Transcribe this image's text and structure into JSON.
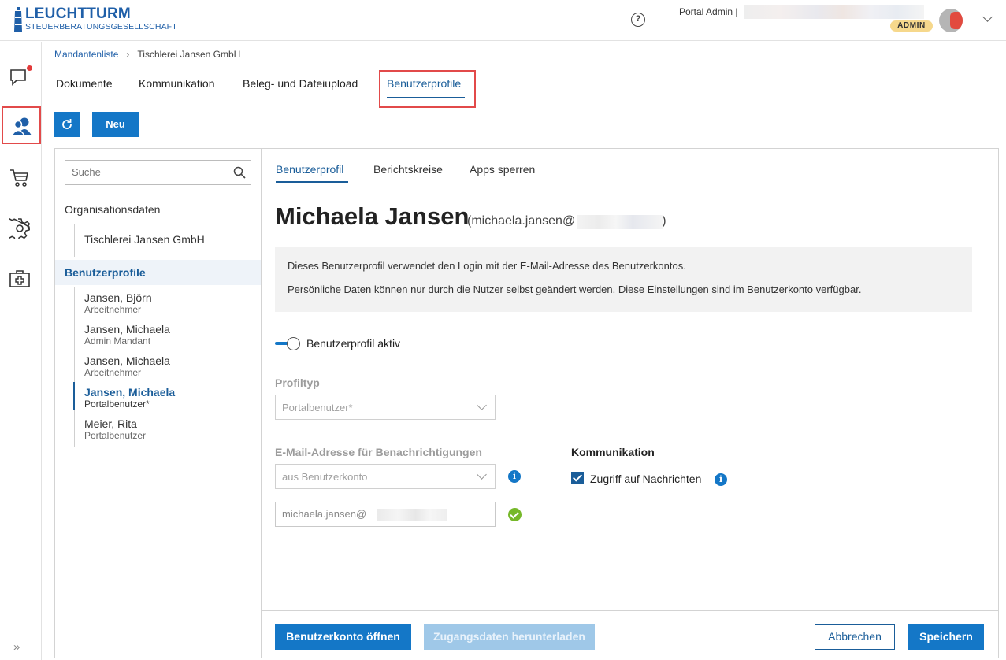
{
  "header": {
    "logo_line1": "LEUCHTTURM",
    "logo_line2": "STEUERBERATUNGSGESELLSCHAFT",
    "user_label": "Portal Admin |",
    "role_badge": "ADMIN"
  },
  "rail": {
    "items": [
      "messages-icon",
      "users-icon",
      "cart-icon",
      "gear-icon",
      "medical-kit-icon"
    ],
    "expand_glyph": "»"
  },
  "breadcrumb": {
    "root": "Mandantenliste",
    "current": "Tischlerei Jansen GmbH"
  },
  "main_tabs": [
    {
      "label": "Dokumente"
    },
    {
      "label": "Kommunikation"
    },
    {
      "label": "Beleg- und Dateiupload"
    },
    {
      "label": "Benutzerprofile",
      "active": true
    }
  ],
  "toolbar": {
    "new_label": "Neu"
  },
  "sidebar": {
    "search_placeholder": "Suche",
    "org_section": "Organisationsdaten",
    "org_item": "Tischlerei Jansen GmbH",
    "profiles_section": "Benutzerprofile",
    "people": [
      {
        "name": "Jansen, Björn",
        "role": "Arbeitnehmer"
      },
      {
        "name": "Jansen, Michaela",
        "role": "Admin Mandant"
      },
      {
        "name": "Jansen, Michaela",
        "role": "Arbeitnehmer"
      },
      {
        "name": "Jansen, Michaela",
        "role": "Portalbenutzer*",
        "selected": true
      },
      {
        "name": "Meier, Rita",
        "role": "Portalbenutzer"
      }
    ]
  },
  "detail": {
    "tabs": [
      {
        "label": "Benutzerprofil",
        "active": true
      },
      {
        "label": "Berichtskreise"
      },
      {
        "label": "Apps sperren"
      }
    ],
    "name": "Michaela Jansen",
    "email_prefix": "(michaela.jansen@",
    "email_suffix": ")",
    "info_line1": "Dieses Benutzerprofil verwendet den Login mit der E-Mail-Adresse des Benutzerkontos.",
    "info_line2": "Persönliche Daten können nur durch die Nutzer selbst geändert werden. Diese Einstellungen sind im Benutzerkonto verfügbar.",
    "toggle_label": "Benutzerprofil aktiv",
    "toggle_on": true,
    "profiltyp_label": "Profiltyp",
    "profiltyp_value": "Portalbenutzer*",
    "email_notif_label": "E-Mail-Adresse für Benachrichtigungen",
    "email_source_value": "aus Benutzerkonto",
    "email_value": "michaela.jansen@",
    "communication_label": "Kommunikation",
    "message_access_label": "Zugriff auf Nachrichten",
    "message_access_checked": true
  },
  "footer": {
    "open_account": "Benutzerkonto öffnen",
    "download_credentials": "Zugangsdaten herunterladen",
    "cancel": "Abbrechen",
    "save": "Speichern"
  },
  "colors": {
    "primary": "#1477c7",
    "accent_text": "#1a5d99",
    "highlight_frame": "#e24a4a",
    "badge": "#f6d88c",
    "success": "#76b82a"
  }
}
